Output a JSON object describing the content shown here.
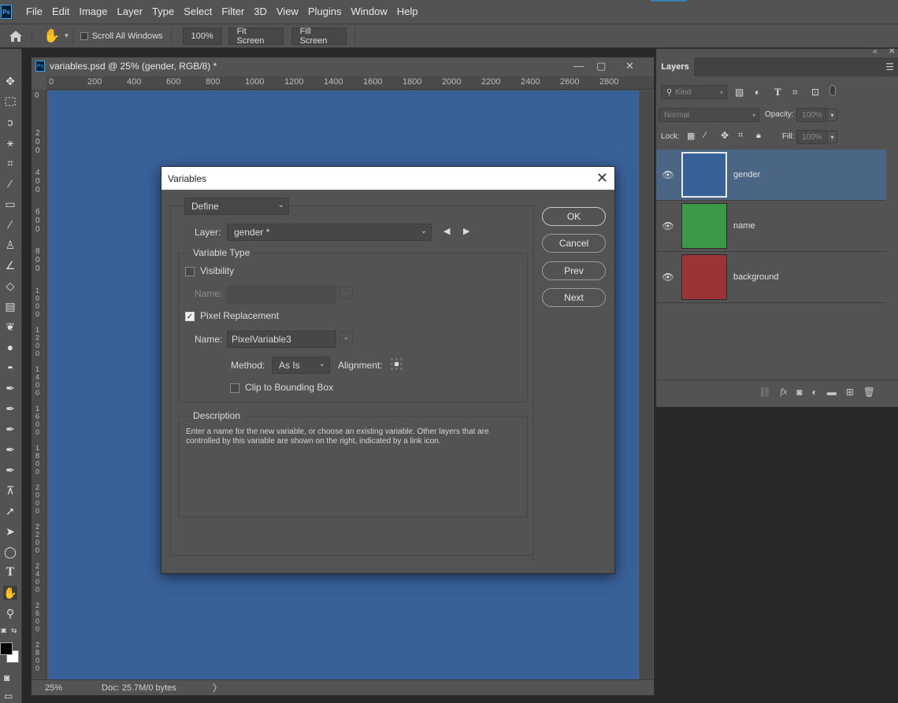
{
  "app": {
    "logo": "Ps"
  },
  "menu": [
    "File",
    "Edit",
    "Image",
    "Layer",
    "Type",
    "Select",
    "Filter",
    "3D",
    "View",
    "Plugins",
    "Window",
    "Help"
  ],
  "options_bar": {
    "scroll_all_windows": "Scroll All Windows",
    "zoom_value": "100%",
    "fit_screen": "Fit Screen",
    "fill_screen": "Fill Screen"
  },
  "document": {
    "title": "variables.psd @ 25% (gender, RGB/8) *",
    "ruler_top": [
      "0",
      "200",
      "400",
      "600",
      "800",
      "1000",
      "1200",
      "1400",
      "1600",
      "1800",
      "2000",
      "2200",
      "2400",
      "2600",
      "2800"
    ],
    "ruler_left": [
      "0",
      "200",
      "400",
      "600",
      "800",
      "1000",
      "1200",
      "1400",
      "1600",
      "1800",
      "2000",
      "2200",
      "2400",
      "2600",
      "2800"
    ],
    "zoom": "25%",
    "doc_info": "Doc: 25.7M/0 bytes",
    "canvas_color": "#386199"
  },
  "layers_panel": {
    "tab": "Layers",
    "filter_kind": "Kind",
    "blend_mode": "Normal",
    "opacity_label": "Opacity:",
    "opacity_value": "100%",
    "lock_label": "Lock:",
    "fill_label": "Fill:",
    "fill_value": "100%",
    "layers": [
      {
        "name": "gender",
        "color": "#386199",
        "selected": true
      },
      {
        "name": "name",
        "color": "#3a9a45",
        "selected": false
      },
      {
        "name": "background",
        "color": "#9b3535",
        "selected": false
      }
    ]
  },
  "dialog": {
    "title": "Variables",
    "mode": "Define",
    "layer_label": "Layer:",
    "layer_value": "gender *",
    "variable_type_label": "Variable Type",
    "visibility_label": "Visibility",
    "visibility_checked": false,
    "visibility_name_label": "Name:",
    "pixel_replacement_label": "Pixel Replacement",
    "pixel_replacement_checked": true,
    "pixel_name_label": "Name:",
    "pixel_name_value": "PixelVariable3",
    "method_label": "Method:",
    "method_value": "As Is",
    "alignment_label": "Alignment:",
    "clip_label": "Clip to Bounding Box",
    "clip_checked": false,
    "description_label": "Description",
    "description_text": "Enter a name for the new variable, or choose an existing variable. Other layers that are controlled by this variable are shown on the right, indicated by a link icon.",
    "buttons": {
      "ok": "OK",
      "cancel": "Cancel",
      "prev": "Prev",
      "next": "Next"
    }
  }
}
